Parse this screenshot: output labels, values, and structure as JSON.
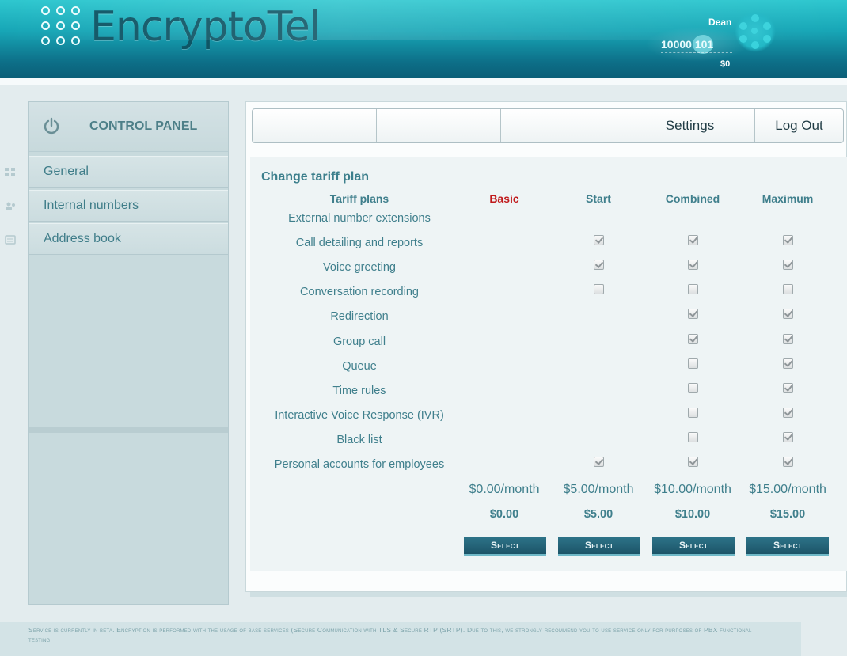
{
  "brand": {
    "name": "EncryptoTel"
  },
  "user": {
    "name": "Dean",
    "number": "10000 101",
    "balance": "$0"
  },
  "sidebar": {
    "title": "CONTROL PANEL",
    "items": [
      {
        "label": "General"
      },
      {
        "label": "Internal numbers"
      },
      {
        "label": "Address book"
      }
    ]
  },
  "topnav": {
    "tabs": [
      {
        "label": ""
      },
      {
        "label": ""
      },
      {
        "label": ""
      },
      {
        "label": "Settings"
      },
      {
        "label": "Log Out"
      }
    ]
  },
  "tariff": {
    "title": "Change tariff plan",
    "features_header": "Tariff plans",
    "plans": [
      {
        "name": "Basic",
        "monthly": "$0.00/month",
        "total": "$0.00",
        "button": "Select",
        "highlight_color": "#c0191b"
      },
      {
        "name": "Start",
        "monthly": "$5.00/month",
        "total": "$5.00",
        "button": "Select"
      },
      {
        "name": "Combined",
        "monthly": "$10.00/month",
        "total": "$10.00",
        "button": "Select"
      },
      {
        "name": "Maximum",
        "monthly": "$15.00/month",
        "total": "$15.00",
        "button": "Select"
      }
    ],
    "features": [
      {
        "label": "External number extensions",
        "states": [
          null,
          null,
          null,
          null
        ]
      },
      {
        "label": "Call detailing and reports",
        "states": [
          null,
          true,
          true,
          true
        ]
      },
      {
        "label": "Voice greeting",
        "states": [
          null,
          true,
          true,
          true
        ]
      },
      {
        "label": "Conversation recording",
        "states": [
          null,
          false,
          false,
          false
        ]
      },
      {
        "label": "Redirection",
        "states": [
          null,
          null,
          true,
          true
        ]
      },
      {
        "label": "Group call",
        "states": [
          null,
          null,
          true,
          true
        ]
      },
      {
        "label": "Queue",
        "states": [
          null,
          null,
          false,
          true
        ]
      },
      {
        "label": "Time rules",
        "states": [
          null,
          null,
          false,
          true
        ]
      },
      {
        "label": "Interactive Voice Response (IVR)",
        "states": [
          null,
          null,
          false,
          true
        ]
      },
      {
        "label": "Black list",
        "states": [
          null,
          null,
          false,
          true
        ]
      },
      {
        "label": "Personal accounts for employees",
        "states": [
          null,
          true,
          true,
          true
        ]
      }
    ]
  },
  "footer": {
    "text": "Service is currently in beta. Encryption is performed with the usage of base services (Secure Communication with TLS & Secure RTP (SRTP). Due to this, we strongly recommend you to use service only for purposes of PBX functional testing."
  },
  "colors": {
    "accent": "#17a6b6",
    "text": "#3f7f8c",
    "button": "#1c5468"
  }
}
